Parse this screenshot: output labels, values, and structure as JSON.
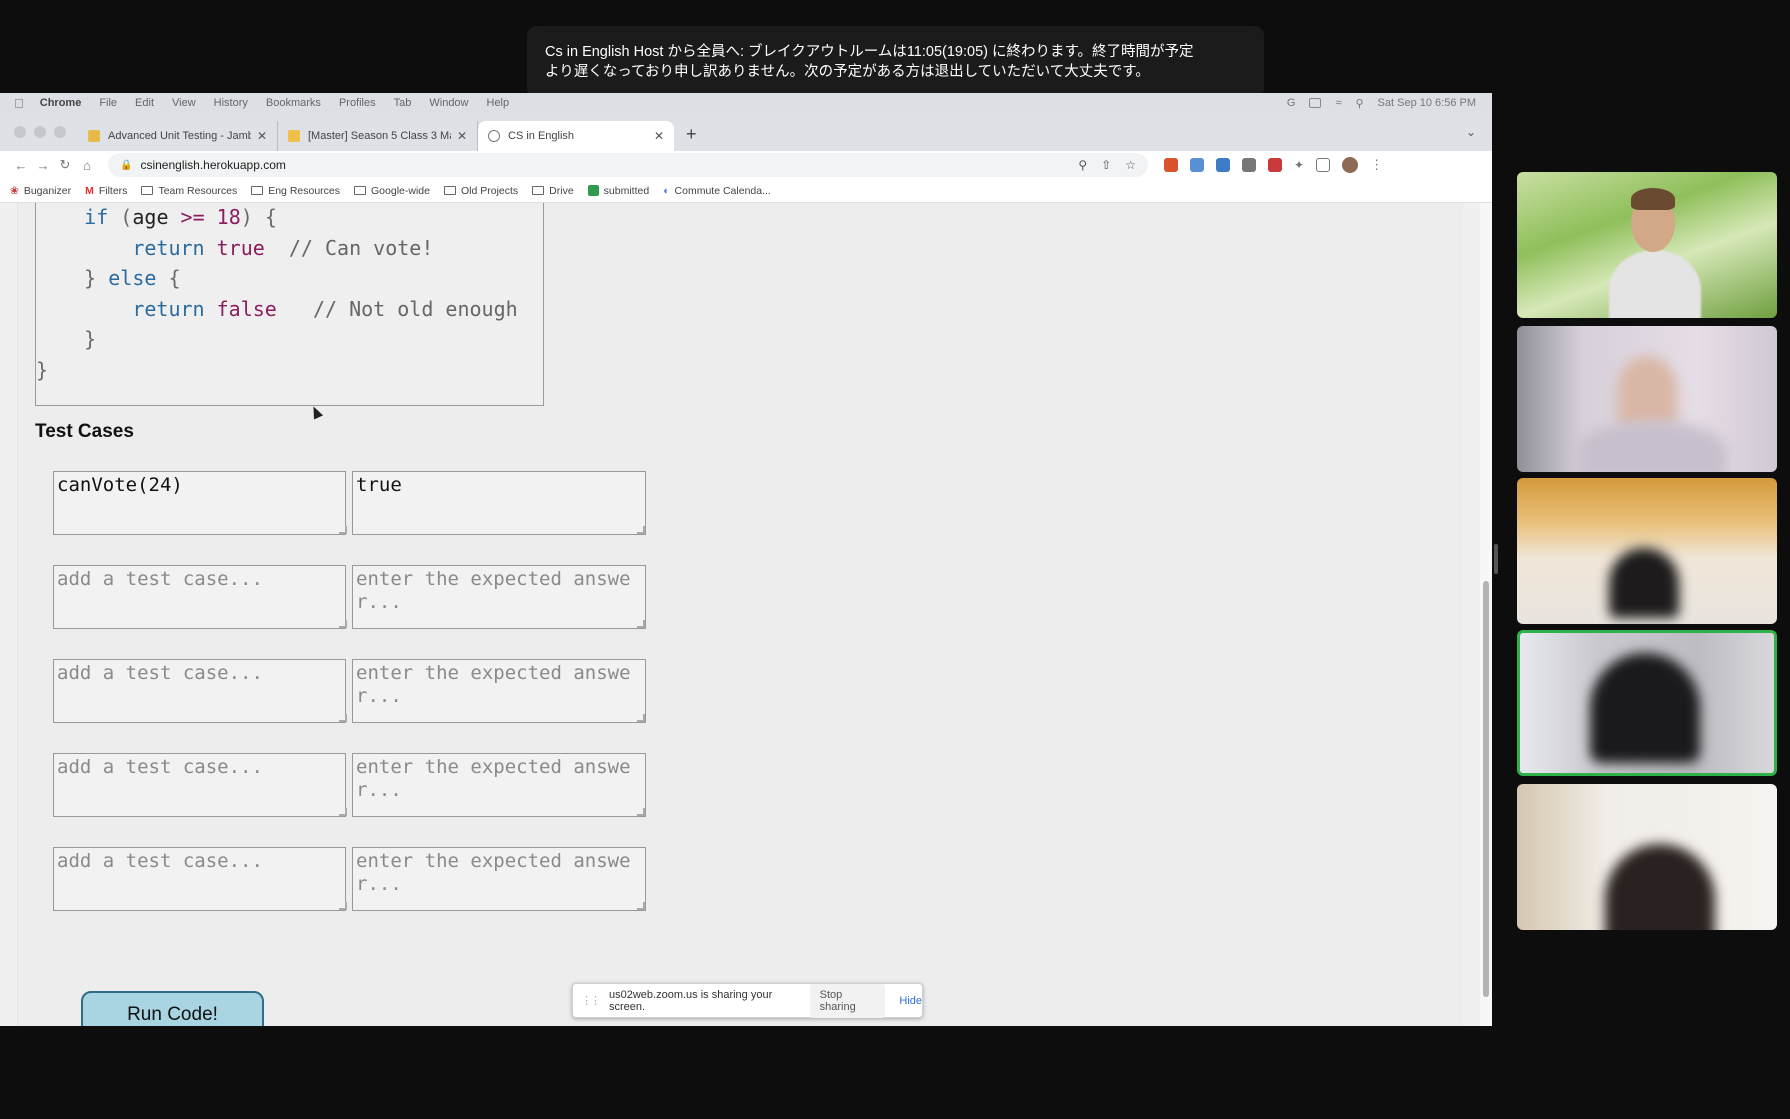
{
  "zoom_banner": {
    "line1": "Cs in English Host から全員へ: ブレイクアウトルームは11:05(19:05) に終わります。終了時間が予定",
    "line2": "より遅くなっており申し訳ありません。次の予定がある方は退出していただいて大丈夫です。"
  },
  "mac_menu": {
    "app": "Chrome",
    "items": [
      "File",
      "Edit",
      "View",
      "History",
      "Bookmarks",
      "Profiles",
      "Tab",
      "Window",
      "Help"
    ],
    "clock": "Sat Sep 10  6:56 PM"
  },
  "browser": {
    "tabs": [
      {
        "title": "Advanced Unit Testing - Jamb",
        "favicon_color": "#e8b84a"
      },
      {
        "title": "[Master] Season 5 Class 3 Ma",
        "favicon_color": "#f2c04a"
      },
      {
        "title": "CS in English",
        "favicon_color": "#777777"
      }
    ],
    "url": "csinenglish.herokuapp.com",
    "bookmarks": [
      "Buganizer",
      "Filters",
      "Team Resources",
      "Eng Resources",
      "Google-wide",
      "Old Projects",
      "Drive",
      "submitted",
      "Commute Calenda..."
    ]
  },
  "code": {
    "line1_kw": "if",
    "line1_open": " (",
    "line1_var": "age",
    "line1_op": " >= ",
    "line1_num": "18",
    "line1_close": ") {",
    "line2_kw": "return",
    "line2_lit": " true",
    "line2_cmt": "  // Can vote!",
    "line3_brace": "} ",
    "line3_kw": "else",
    "line3_open": " {",
    "line4_kw": "return",
    "line4_lit": " false",
    "line4_cmt": "   // Not old enough",
    "line5": "}",
    "line6": "}"
  },
  "test_cases": {
    "heading": "Test Cases",
    "rows": [
      {
        "input": "canVote(24)",
        "expected": "true"
      },
      {
        "input": "add a test case...",
        "expected": "enter the expected answer..."
      },
      {
        "input": "add a test case...",
        "expected": "enter the expected answer..."
      },
      {
        "input": "add a test case...",
        "expected": "enter the expected answer..."
      },
      {
        "input": "add a test case...",
        "expected": "enter the expected answer..."
      }
    ]
  },
  "run_button": "Run Code!",
  "share_bar": {
    "message": "us02web.zoom.us is sharing your screen.",
    "stop": "Stop sharing",
    "hide": "Hide"
  }
}
